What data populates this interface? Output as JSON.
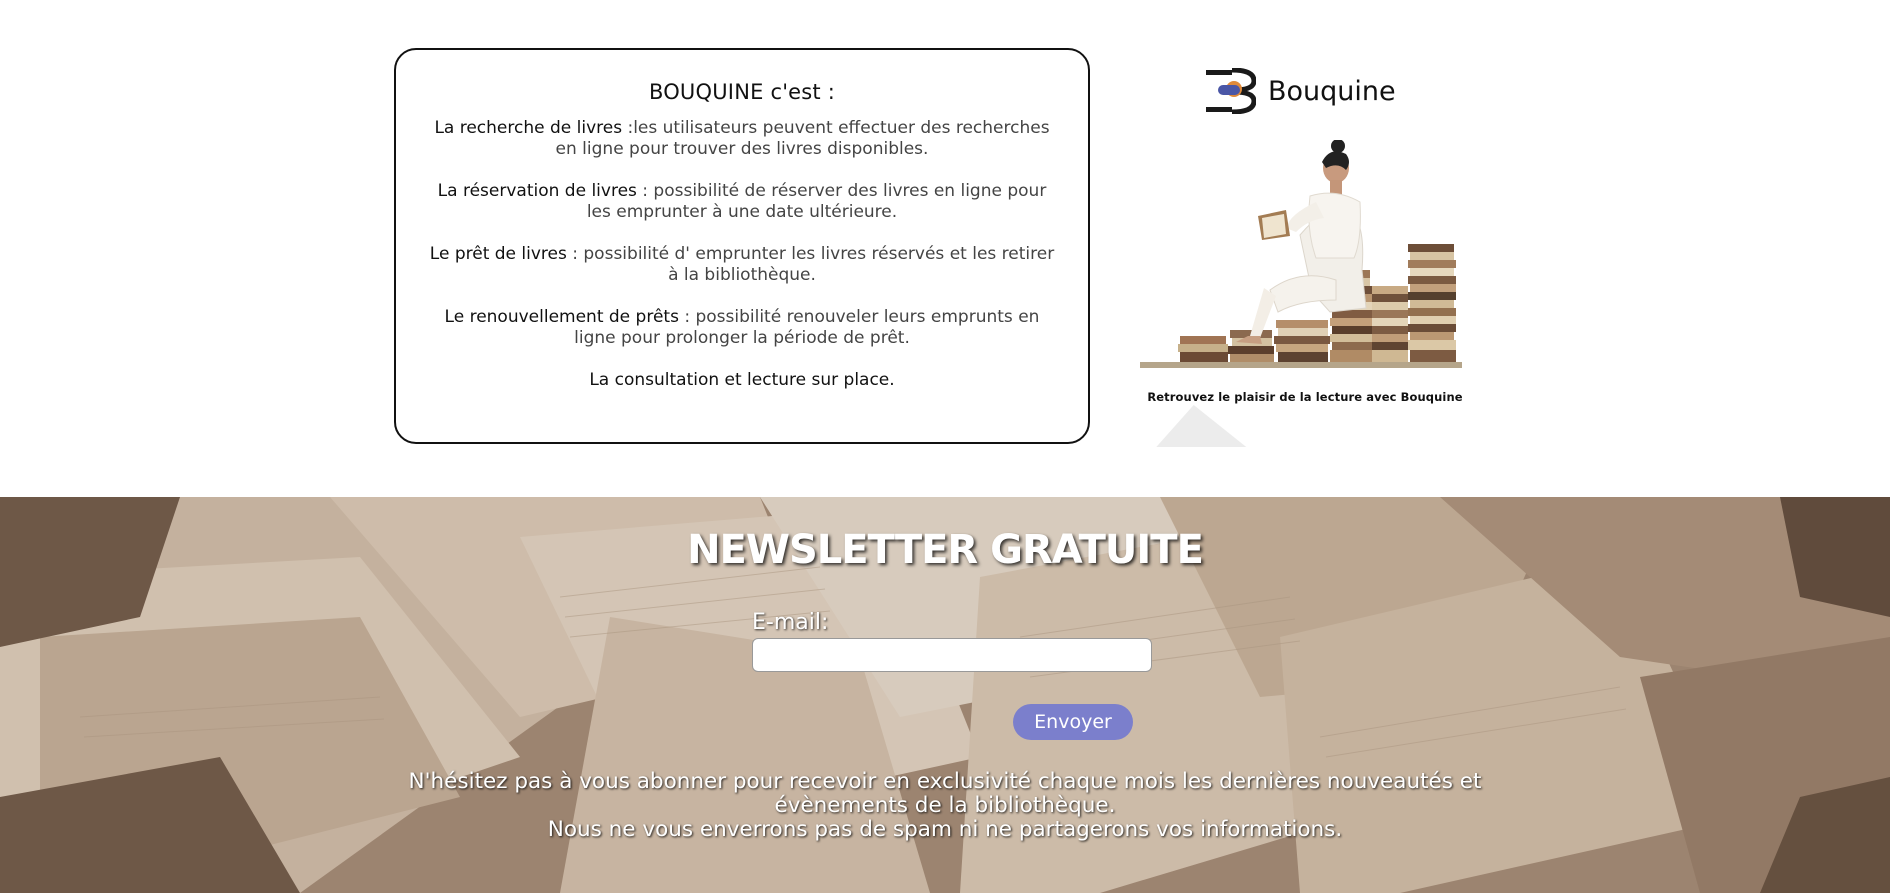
{
  "info": {
    "title": "BOUQUINE c'est :",
    "items": [
      {
        "label": "La recherche de livres",
        "text": " :les utilisateurs peuvent effectuer des recherches en ligne pour trouver des livres disponibles."
      },
      {
        "label": "La réservation de livres",
        "text": " : possibilité de réserver des livres en ligne pour les emprunter à une date ultérieure."
      },
      {
        "label": "Le prêt de livres",
        "text": " : possibilité d' emprunter les livres réservés et les retirer à la bibliothèque."
      },
      {
        "label": "Le renouvellement de prêts",
        "text": " : possibilité renouveler leurs emprunts en ligne pour prolonger la période de prêt."
      }
    ],
    "last": "La consultation et lecture sur place."
  },
  "brand": {
    "name": "Bouquine",
    "tagline": "Retrouvez le plaisir de la lecture avec Bouquine"
  },
  "newsletter": {
    "title": "NEWSLETTER GRATUITE",
    "email_label": "E-mail:",
    "email_value": "",
    "send_label": "Envoyer",
    "text_line1": "N'hésitez pas à vous abonner pour recevoir en exclusivité chaque mois les dernières nouveautés et évènements de la bibliothèque.",
    "text_line2": "Nous ne vous enverrons pas de spam ni ne partagerons vos informations."
  },
  "colors": {
    "button": "#7b7fcc",
    "logo_blue": "#4a56a6",
    "logo_orange": "#e08a3a",
    "card_border": "#111111"
  }
}
